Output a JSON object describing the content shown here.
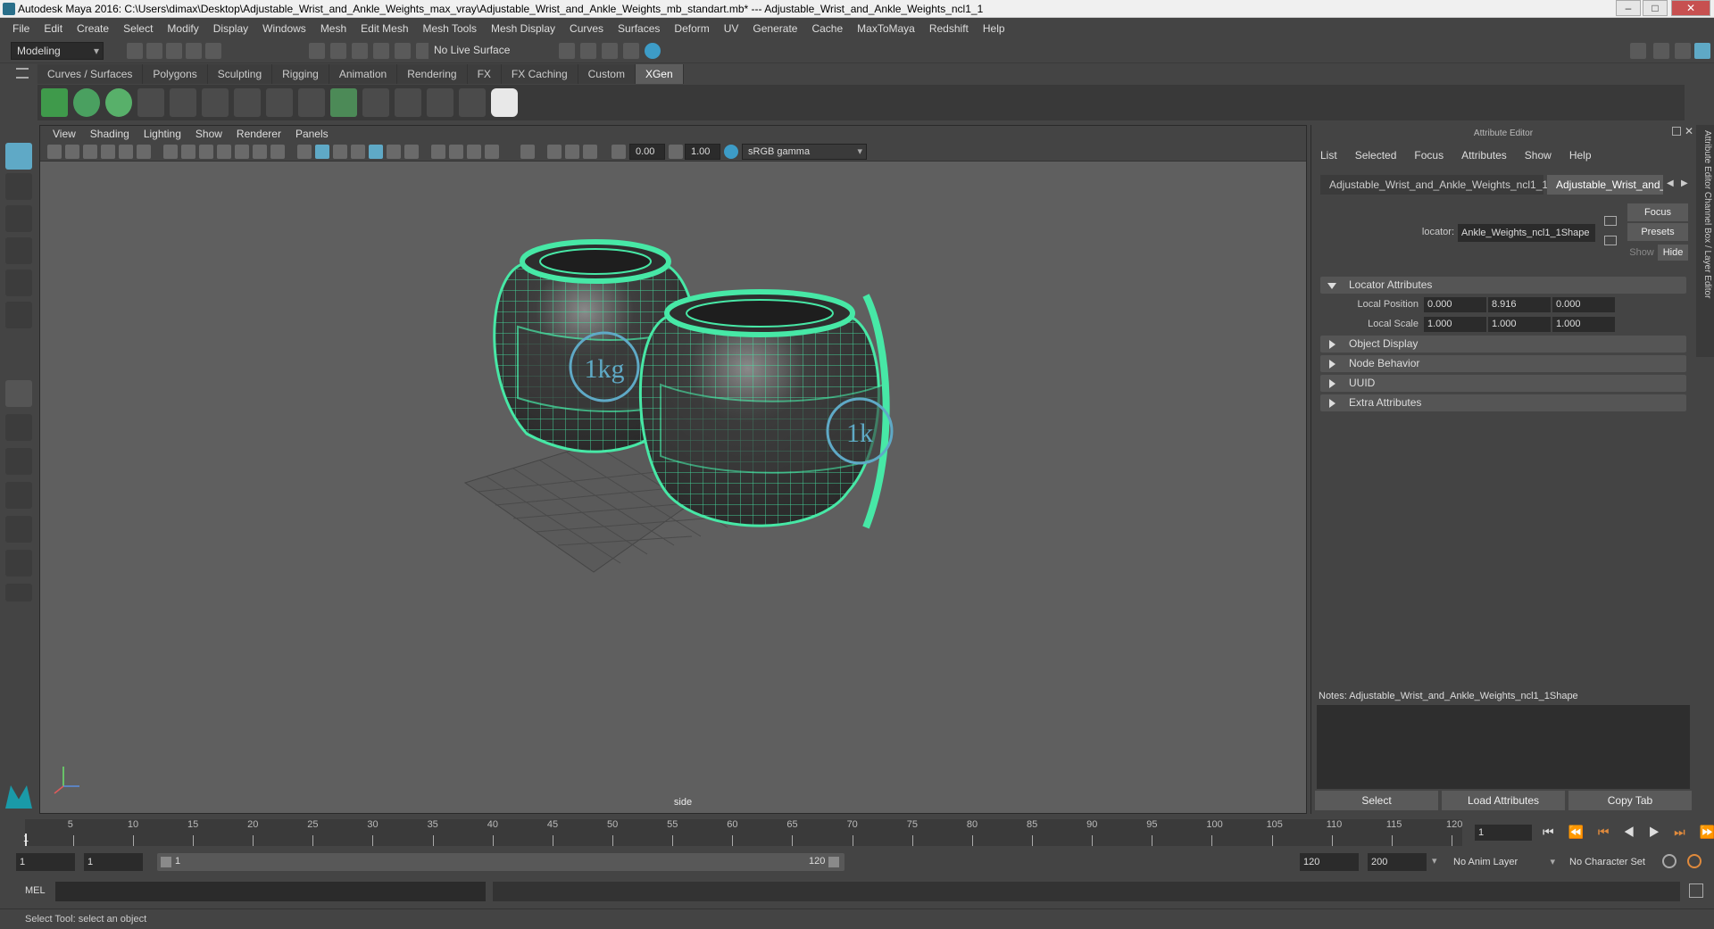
{
  "window": {
    "title": "Autodesk Maya 2016: C:\\Users\\dimax\\Desktop\\Adjustable_Wrist_and_Ankle_Weights_max_vray\\Adjustable_Wrist_and_Ankle_Weights_mb_standart.mb* --- Adjustable_Wrist_and_Ankle_Weights_ncl1_1"
  },
  "menubar": [
    "File",
    "Edit",
    "Create",
    "Select",
    "Modify",
    "Display",
    "Windows",
    "Mesh",
    "Edit Mesh",
    "Mesh Tools",
    "Mesh Display",
    "Curves",
    "Surfaces",
    "Deform",
    "UV",
    "Generate",
    "Cache",
    "MaxToMaya",
    "Redshift",
    "Help"
  ],
  "statusline": {
    "mode": "Modeling",
    "live_surface": "No Live Surface"
  },
  "shelf_tabs": [
    "Curves / Surfaces",
    "Polygons",
    "Sculpting",
    "Rigging",
    "Animation",
    "Rendering",
    "FX",
    "FX Caching",
    "Custom",
    "XGen"
  ],
  "viewport": {
    "menu": [
      "View",
      "Shading",
      "Lighting",
      "Show",
      "Renderer",
      "Panels"
    ],
    "exposure": "0.00",
    "gamma": "1.00",
    "colorspace": "sRGB gamma",
    "camera_label": "side",
    "label_left": "1kg",
    "label_right": "1k"
  },
  "attribute_editor": {
    "title": "Attribute Editor",
    "menu": [
      "List",
      "Selected",
      "Focus",
      "Attributes",
      "Show",
      "Help"
    ],
    "tabs": [
      "Adjustable_Wrist_and_Ankle_Weights_ncl1_1",
      "Adjustable_Wrist_and_"
    ],
    "locator_label": "locator:",
    "locator_value": "Ankle_Weights_ncl1_1Shape",
    "focus": "Focus",
    "presets": "Presets",
    "show": "Show",
    "hide": "Hide",
    "sections": {
      "locator": "Locator Attributes",
      "object_display": "Object Display",
      "node_behavior": "Node Behavior",
      "uuid": "UUID",
      "extra": "Extra Attributes"
    },
    "local_position": {
      "label": "Local Position",
      "x": "0.000",
      "y": "8.916",
      "z": "0.000"
    },
    "local_scale": {
      "label": "Local Scale",
      "x": "1.000",
      "y": "1.000",
      "z": "1.000"
    },
    "notes": "Notes:  Adjustable_Wrist_and_Ankle_Weights_ncl1_1Shape",
    "buttons": {
      "select": "Select",
      "load": "Load Attributes",
      "copy": "Copy Tab"
    },
    "side_tabs": "Attribute Editor    Channel Box / Layer Editor"
  },
  "timeline": {
    "ticks": [
      "5",
      "10",
      "15",
      "20",
      "25",
      "30",
      "35",
      "40",
      "45",
      "50",
      "55",
      "60",
      "65",
      "70",
      "75",
      "80",
      "85",
      "90",
      "95",
      "100",
      "105",
      "110",
      "115",
      "120"
    ],
    "start_label": "1",
    "current_frame": "1"
  },
  "range": {
    "start": "1",
    "playback_start": "1",
    "slider_start": "1",
    "slider_end": "120",
    "playback_end": "120",
    "end": "200",
    "anim_layer": "No Anim Layer",
    "char_set": "No Character Set"
  },
  "cmd": {
    "label": "MEL"
  },
  "help_line": "Select Tool: select an object",
  "colors": {
    "accent": "#5fa9c6",
    "wire": "#47e8a6"
  }
}
